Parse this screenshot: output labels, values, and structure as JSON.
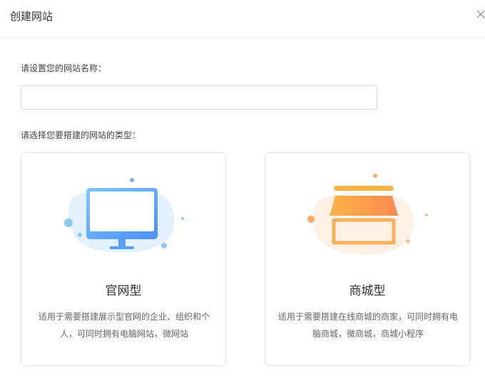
{
  "dialog": {
    "title": "创建网站",
    "close_icon": "close-icon"
  },
  "form": {
    "name_label": "请设置您的网站名称：",
    "name_value": "",
    "name_placeholder": "",
    "type_label": "请选择您要搭建的网站的类型："
  },
  "types": [
    {
      "title": "官网型",
      "desc": "适用于需要搭建展示型官网的企业、组织和个人，可同时拥有电脑网站，微网站",
      "icon": "monitor-icon",
      "accent": "#5aa9f5"
    },
    {
      "title": "商城型",
      "desc": "适用于需要搭建在线商城的商家，可同时拥有电脑商城，微商城，商城小程序",
      "icon": "storefront-icon",
      "accent": "#f7a64b"
    }
  ]
}
